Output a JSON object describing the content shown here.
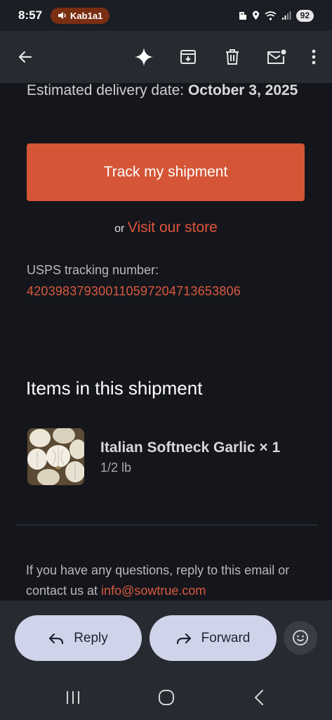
{
  "status": {
    "time": "8:57",
    "call_label": "Kab1a1",
    "battery": "92"
  },
  "email": {
    "delivery_label": "Estimated delivery date: ",
    "delivery_date": "October 3, 2025",
    "track_button": "Track my shipment",
    "or_text": "or",
    "visit_link": "Visit our store",
    "usps_label": "USPS tracking number:",
    "usps_number": "420398379300110597204713653806",
    "items_heading": "Items in this shipment",
    "product": {
      "name": "Italian Softneck Garlic × 1",
      "quantity": "1/2 lb",
      "image_icon": "garlic-photo"
    },
    "questions_text": "If you have any questions, reply to this email or contact us at ",
    "contact_email": "info@sowtrue.com"
  },
  "actions": {
    "reply": "Reply",
    "forward": "Forward"
  },
  "colors": {
    "accent": "#d55537",
    "link": "#d95a3d",
    "pill": "#cfd4ea",
    "background": "#14161c"
  },
  "icons": [
    "back-arrow-icon",
    "sparkle-icon",
    "archive-icon",
    "trash-icon",
    "mark-unread-icon",
    "more-vert-icon",
    "reply-icon",
    "forward-icon",
    "emoji-icon",
    "recents-icon",
    "home-icon",
    "back-nav-icon"
  ]
}
